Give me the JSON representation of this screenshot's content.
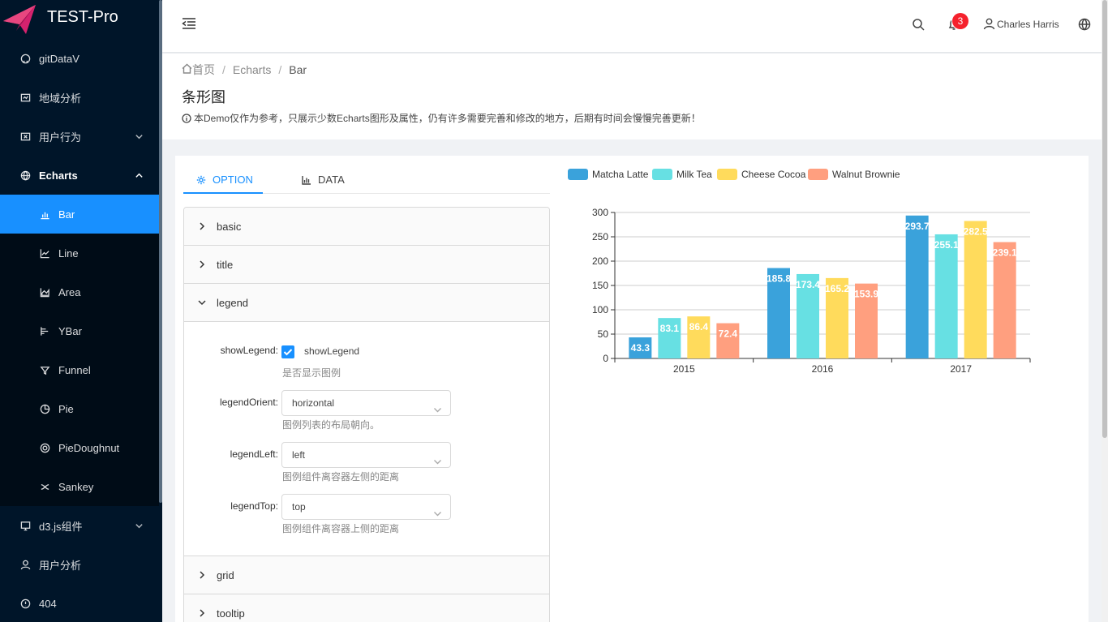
{
  "app": {
    "title": "TEST-Pro"
  },
  "colors": {
    "sidebar": "#001529",
    "submenu": "#000c17",
    "accent": "#1890ff",
    "badge": "#f5222d"
  },
  "sidebar": {
    "items": [
      {
        "label": "gitDataV",
        "icon": "github-icon"
      },
      {
        "label": "地域分析",
        "icon": "map-icon"
      },
      {
        "label": "用户行为",
        "icon": "behavior-icon",
        "has_submenu": true
      },
      {
        "label": "Echarts",
        "icon": "globe-icon",
        "open": true
      }
    ],
    "echarts_sub": [
      {
        "label": "Bar",
        "icon": "bar-chart-icon",
        "active": true
      },
      {
        "label": "Line",
        "icon": "line-chart-icon"
      },
      {
        "label": "Area",
        "icon": "area-chart-icon"
      },
      {
        "label": "YBar",
        "icon": "ybar-chart-icon"
      },
      {
        "label": "Funnel",
        "icon": "funnel-icon"
      },
      {
        "label": "Pie",
        "icon": "pie-chart-icon"
      },
      {
        "label": "PieDoughnut",
        "icon": "doughnut-icon"
      },
      {
        "label": "Sankey",
        "icon": "sankey-icon"
      }
    ],
    "bottom": [
      {
        "label": "d3.js组件",
        "icon": "monitor-icon",
        "has_submenu": true
      },
      {
        "label": "用户分析",
        "icon": "user-icon"
      },
      {
        "label": "404",
        "icon": "warning-icon"
      }
    ]
  },
  "header": {
    "notifications": "3",
    "user_name": "Charles Harris"
  },
  "breadcrumb": {
    "home": "首页",
    "section": "Echarts",
    "current": "Bar"
  },
  "page": {
    "title": "条形图",
    "description": "本Demo仅作为参考，只展示少数Echarts图形及属性，仍有许多需要完善和修改的地方，后期有时间会慢慢完善更新！"
  },
  "tabs": [
    {
      "label": "OPTION",
      "active": true
    },
    {
      "label": "DATA",
      "active": false
    }
  ],
  "panels": {
    "basic": "basic",
    "title": "title",
    "legend": "legend",
    "grid": "grid",
    "tooltip": "tooltip"
  },
  "legend_form": {
    "show_legend": {
      "label": "showLegend",
      "checkbox_label": "showLegend",
      "checked": true,
      "help": "是否显示图例"
    },
    "legend_orient": {
      "label": "legendOrient",
      "value": "horizontal",
      "help": "图例列表的布局朝向。"
    },
    "legend_left": {
      "label": "legendLeft",
      "value": "left",
      "help": "图例组件离容器左侧的距离"
    },
    "legend_top": {
      "label": "legendTop",
      "value": "top",
      "help": "图例组件离容器上侧的距离"
    }
  },
  "chart_data": {
    "type": "bar",
    "categories": [
      "2015",
      "2016",
      "2017"
    ],
    "series": [
      {
        "name": "Matcha Latte",
        "color": "#3aa2db",
        "values": [
          43.3,
          185.8,
          293.7
        ]
      },
      {
        "name": "Milk Tea",
        "color": "#67e0e3",
        "values": [
          83.1,
          173.4,
          255.1
        ]
      },
      {
        "name": "Cheese Cocoa",
        "color": "#ffdb5c",
        "values": [
          86.4,
          165.2,
          282.5
        ]
      },
      {
        "name": "Walnut Brownie",
        "color": "#ff9f7f",
        "values": [
          72.4,
          153.9,
          239.1
        ]
      }
    ],
    "ylim": [
      0,
      300
    ],
    "yticks": [
      "0",
      "50",
      "100",
      "150",
      "200",
      "250",
      "300"
    ],
    "grid": true,
    "legend_position": "top-left",
    "data_labels": [
      "43.3",
      "185.8",
      "293.7",
      "83.1",
      "173.4",
      "255.1",
      "86.4",
      "165.2",
      "282.5",
      "72.4",
      "153.9",
      "239.1"
    ]
  }
}
